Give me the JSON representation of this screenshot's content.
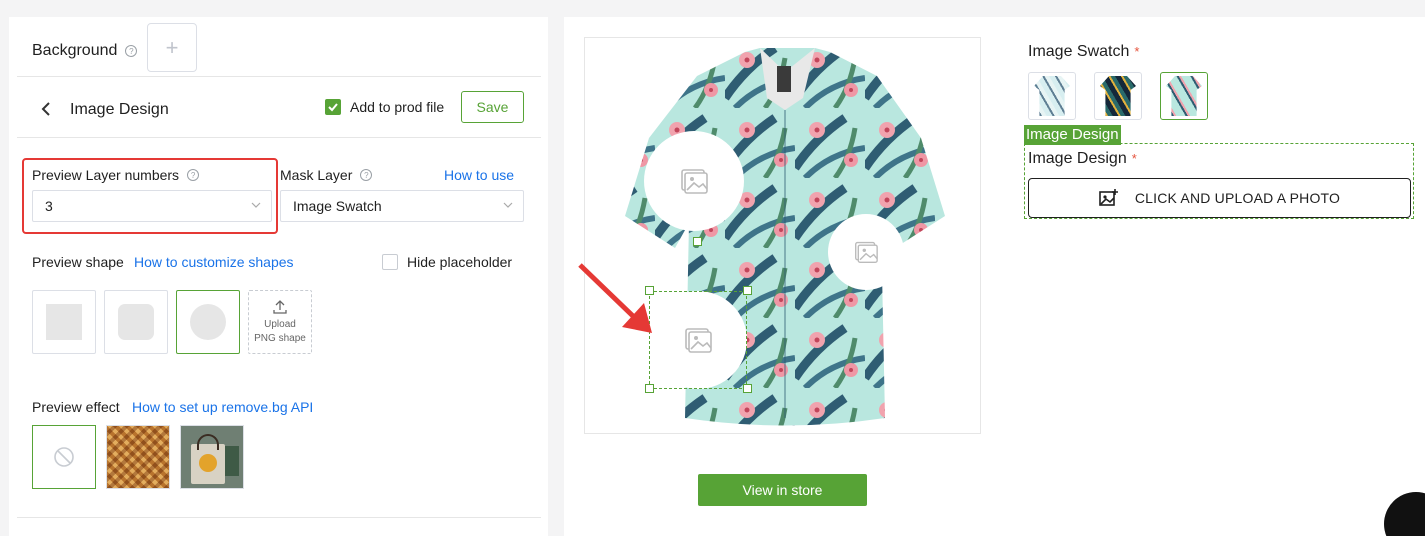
{
  "left": {
    "background_label": "Background",
    "background_add": "+",
    "design_title": "Image Design",
    "add_to_prod_label": "Add to prod file",
    "add_to_prod_checked": true,
    "save_label": "Save",
    "preview_layer_label": "Preview Layer numbers",
    "preview_layer_value": "3",
    "mask_layer_label": "Mask Layer",
    "how_to_use": "How to use",
    "mask_layer_value": "Image Swatch",
    "preview_shape_label": "Preview shape",
    "customize_shapes_link": "How to customize shapes",
    "hide_placeholder_label": "Hide placeholder",
    "hide_placeholder_checked": false,
    "shapes": [
      "square",
      "rounded-square",
      "circle"
    ],
    "selected_shape": "circle",
    "upload_shape_line1": "Upload",
    "upload_shape_line2": "PNG shape",
    "preview_effect_label": "Preview effect",
    "removebg_link": "How to set up remove.bg API",
    "effects": [
      "none-icon",
      "woven-texture",
      "tote-bag-mockup"
    ],
    "selected_effect": "none-icon"
  },
  "right": {
    "view_store_label": "View in store",
    "swatch_title": "Image Swatch",
    "required_mark": "*",
    "swatches": [
      "shirt-swatch-1",
      "shirt-swatch-2",
      "shirt-swatch-3"
    ],
    "selected_swatch": 2,
    "image_design_tag": "Image Design",
    "image_design_label": "Image Design",
    "upload_label": "CLICK AND UPLOAD A PHOTO"
  },
  "colors": {
    "accent": "#57a336",
    "link": "#1a73e8",
    "highlight": "#e53935",
    "required": "#e5533d"
  }
}
